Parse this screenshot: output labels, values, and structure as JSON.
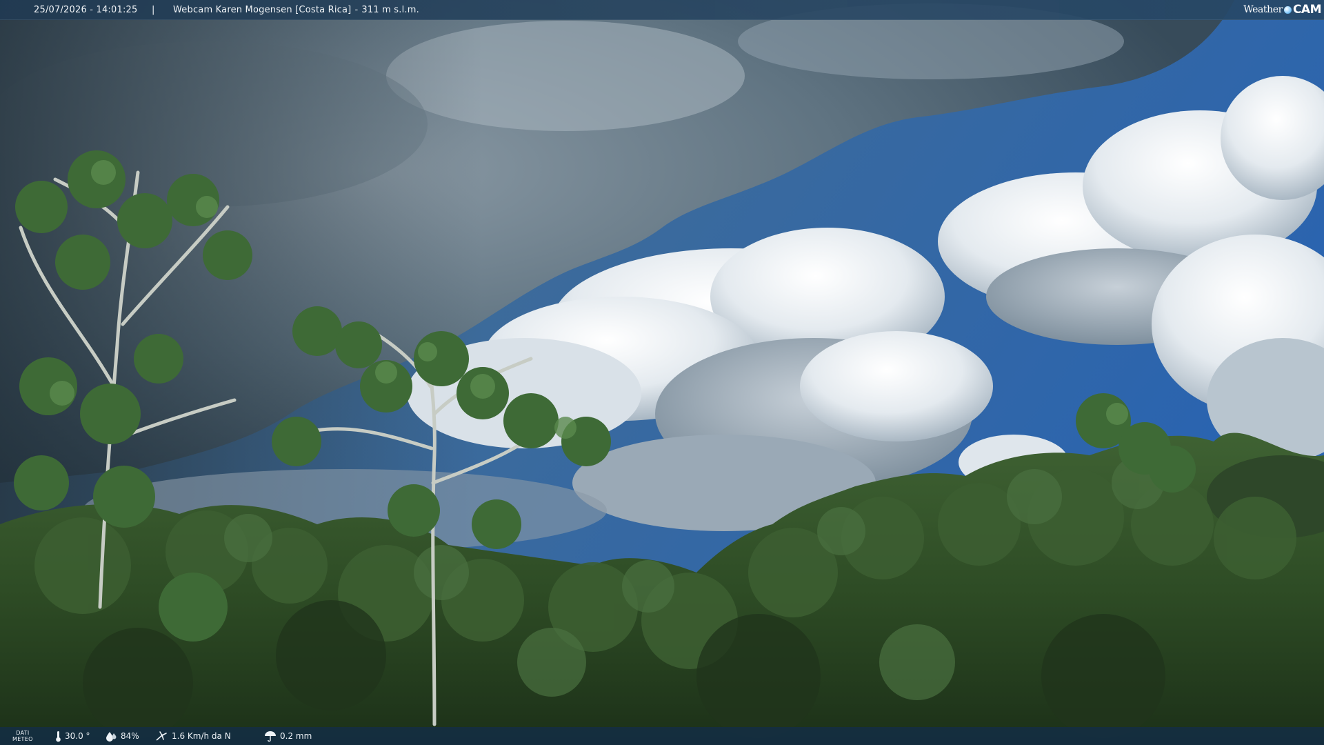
{
  "overlay": {
    "timestamp": "25/07/2026 - 14:01:25",
    "separator": "|",
    "camera_name": "Webcam Karen Mogensen [Costa Rica]",
    "title_dash": "-",
    "altitude": "311 m s.l.m."
  },
  "logo": {
    "word1": "Weather",
    "word2": "CAM"
  },
  "weather": {
    "label_line1": "DATI",
    "label_line2": "METEO",
    "temperature": "30.0 °",
    "humidity": "84%",
    "wind": "1.6 Km/h da N",
    "rain": "0.2 mm"
  },
  "icons": {
    "temperature": "thermometer-icon",
    "humidity": "humidity-drop-icon",
    "wind": "wind-icon",
    "rain": "rain-icon"
  },
  "colors": {
    "bar_background": "#203a52",
    "sky": "#2f6aad",
    "foliage": "#2c4a26"
  }
}
